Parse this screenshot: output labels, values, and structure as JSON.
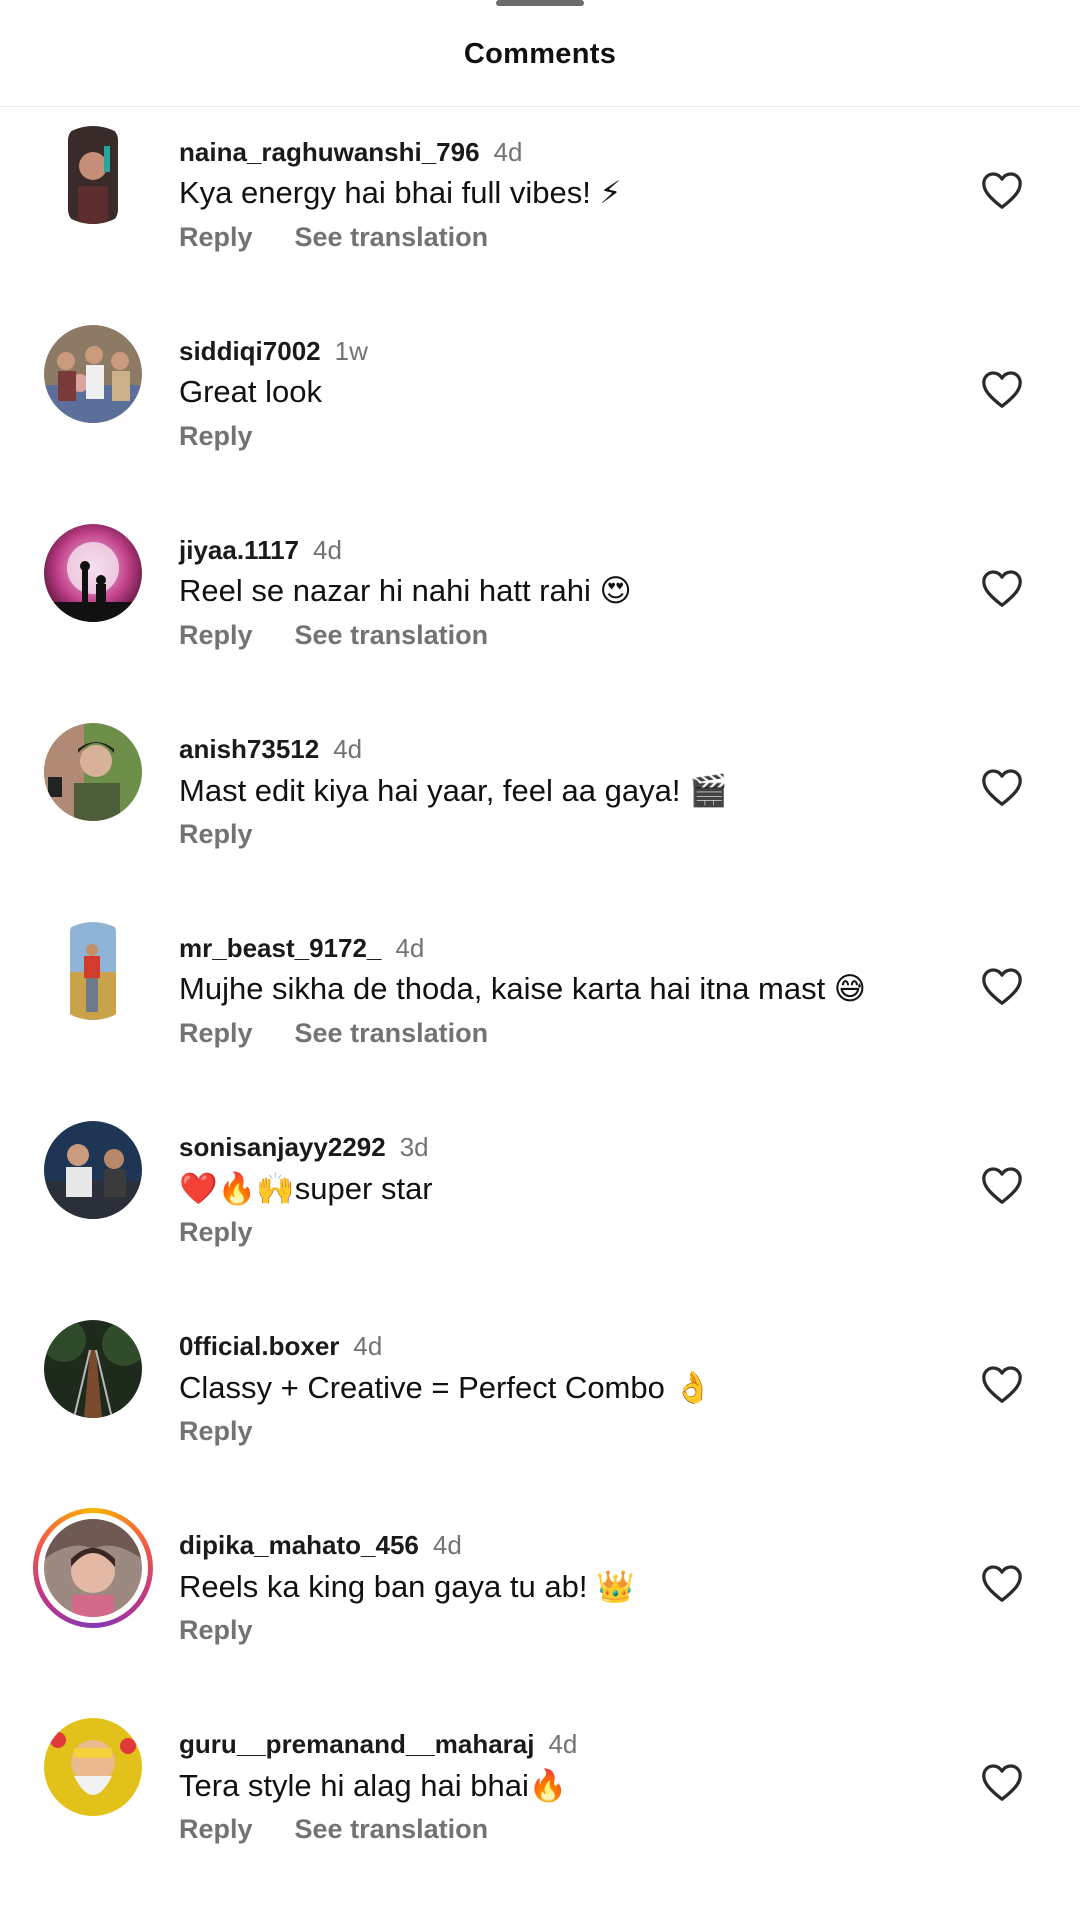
{
  "header": {
    "title": "Comments"
  },
  "comments": [
    {
      "username": "naina_raghuwanshi_796",
      "time": "4d",
      "text": "Kya energy hai bhai full vibes! ⚡",
      "reply": "Reply",
      "translation": "See translation"
    },
    {
      "username": "siddiqi7002",
      "time": "1w",
      "text": "Great look",
      "reply": "Reply",
      "translation": ""
    },
    {
      "username": "jiyaa.1117",
      "time": "4d",
      "text": "Reel se nazar hi nahi hatt rahi 😍",
      "reply": "Reply",
      "translation": "See translation"
    },
    {
      "username": "anish73512",
      "time": "4d",
      "text": "Mast edit kiya hai yaar, feel aa gaya! 🎬",
      "reply": "Reply",
      "translation": ""
    },
    {
      "username": "mr_beast_9172_",
      "time": "4d",
      "text": "Mujhe sikha de thoda, kaise karta hai itna mast 😅",
      "reply": "Reply",
      "translation": "See translation"
    },
    {
      "username": "sonisanjayy2292",
      "time": "3d",
      "text": "❤️🔥🙌super star",
      "reply": "Reply",
      "translation": ""
    },
    {
      "username": "0fficial.boxer",
      "time": "4d",
      "text": "Classy + Creative = Perfect Combo 👌",
      "reply": "Reply",
      "translation": ""
    },
    {
      "username": "dipika_mahato_456",
      "time": "4d",
      "text": "Reels ka king ban gaya tu ab! 👑",
      "reply": "Reply",
      "translation": ""
    },
    {
      "username": "guru__premanand__maharaj",
      "time": "4d",
      "text": "Tera style hi alag hai bhai🔥",
      "reply": "Reply",
      "translation": "See translation"
    }
  ],
  "icons": {
    "like": "heart-outline-icon"
  },
  "colors": {
    "secondary_text": "#737373",
    "primary_text": "#111111",
    "story_ring": "#c13584"
  }
}
